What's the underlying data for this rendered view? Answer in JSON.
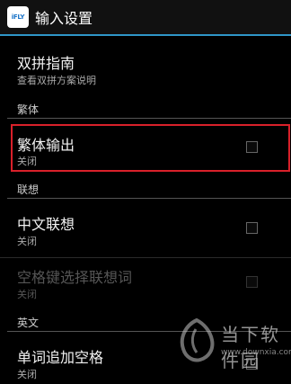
{
  "titlebar": {
    "app_icon_text": "iFLY",
    "title": "输入设置"
  },
  "items": {
    "shuangpin_guide": {
      "title": "双拼指南",
      "subtitle": "查看双拼方案说明"
    },
    "traditional_output": {
      "title": "繁体输出",
      "subtitle": "关闭",
      "checked": false
    },
    "chinese_association": {
      "title": "中文联想",
      "subtitle": "关闭",
      "checked": false
    },
    "space_select_association": {
      "title": "空格键选择联想词",
      "subtitle": "关闭",
      "checked": false,
      "enabled": false
    },
    "word_append_space": {
      "title": "单词追加空格",
      "subtitle": "关闭",
      "checked": false
    }
  },
  "sections": {
    "traditional": "繁体",
    "association": "联想",
    "english": "英文"
  },
  "watermark": {
    "name": "当下软件园",
    "url": "www.downxia.com"
  },
  "colors": {
    "accent": "#2f96c8",
    "highlight": "#d9202a"
  }
}
